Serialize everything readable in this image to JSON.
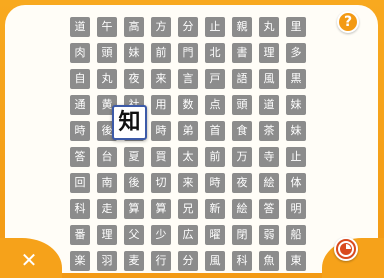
{
  "colors": {
    "frame": "#f6a21a",
    "panel": "#fffdf7",
    "tile": "#8c8c8c",
    "tile_text": "#ffffff",
    "selected_border": "#3c5aa8",
    "timer": "#d94a1e"
  },
  "help_button": {
    "label": "?",
    "icon": "question-icon"
  },
  "close_button": {
    "label": "✕",
    "icon": "close-icon"
  },
  "timer": {
    "icon": "clock-icon"
  },
  "selected_tile": {
    "char": "知"
  },
  "grid": {
    "rows": [
      [
        "道",
        "午",
        "高",
        "方",
        "分",
        "止",
        "親",
        "丸",
        "里",
        "閣"
      ],
      [
        "肉",
        "頭",
        "妹",
        "前",
        "門",
        "北",
        "書",
        "理",
        "多",
        "室"
      ],
      [
        "自",
        "丸",
        "夜",
        "来",
        "言",
        "戸",
        "語",
        "風",
        "黒",
        "数"
      ],
      [
        "通",
        "黄",
        "社",
        "用",
        "数",
        "点",
        "頭",
        "道",
        "妹",
        "書"
      ],
      [
        "時",
        "後",
        "知",
        "時",
        "弟",
        "首",
        "食",
        "茶",
        "妹",
        "会"
      ],
      [
        "答",
        "台",
        "夏",
        "買",
        "太",
        "前",
        "万",
        "寺",
        "止",
        "夏"
      ],
      [
        "回",
        "南",
        "後",
        "切",
        "来",
        "時",
        "夜",
        "絵",
        "体",
        "南"
      ],
      [
        "科",
        "走",
        "算",
        "算",
        "兄",
        "新",
        "絵",
        "答",
        "明",
        "答"
      ],
      [
        "番",
        "理",
        "父",
        "少",
        "広",
        "曜",
        "閉",
        "弱",
        "船",
        "言"
      ],
      [
        "楽",
        "羽",
        "麦",
        "行",
        "分",
        "風",
        "科",
        "魚",
        "東",
        "後"
      ]
    ]
  }
}
